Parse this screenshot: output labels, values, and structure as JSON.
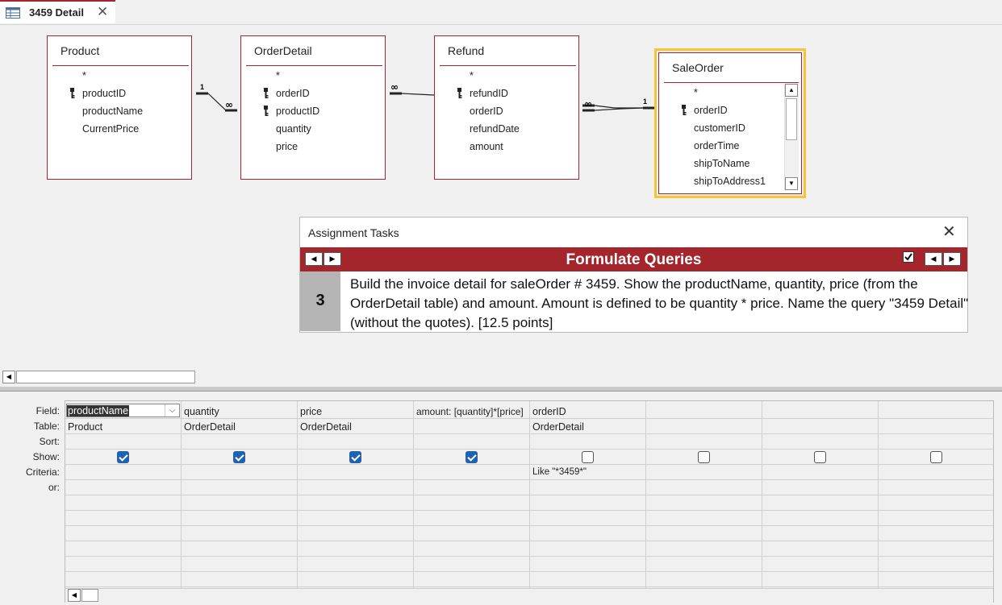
{
  "tab": {
    "title": "3459 Detail"
  },
  "tables": [
    {
      "name": "Product",
      "fields": [
        "*",
        "productID",
        "productName",
        "CurrentPrice"
      ],
      "keys": [
        1
      ]
    },
    {
      "name": "OrderDetail",
      "fields": [
        "*",
        "orderID",
        "productID",
        "quantity",
        "price"
      ],
      "keys": [
        1,
        2
      ]
    },
    {
      "name": "Refund",
      "fields": [
        "*",
        "refundID",
        "orderID",
        "refundDate",
        "amount"
      ],
      "keys": [
        1
      ]
    },
    {
      "name": "SaleOrder",
      "fields": [
        "*",
        "orderID",
        "customerID",
        "orderTime",
        "shipToName",
        "shipToAddress1"
      ],
      "keys": [
        1
      ]
    }
  ],
  "relations": {
    "one": "1",
    "many": "∞"
  },
  "tasks": {
    "title": "Assignment Tasks",
    "heading": "Formulate Queries",
    "number": "3",
    "text": "Build the invoice detail for saleOrder # 3459.  Show the productName, quantity, price (from the OrderDetail table) and amount.  Amount is defined to be quantity * price.  Name the query \"3459 Detail\" (without the quotes). [12.5 points]"
  },
  "grid": {
    "row_labels": [
      "Field:",
      "Table:",
      "Sort:",
      "Show:",
      "Criteria:",
      "or:"
    ],
    "columns": [
      {
        "field": "productName",
        "table": "Product",
        "show": true,
        "criteria": ""
      },
      {
        "field": "quantity",
        "table": "OrderDetail",
        "show": true,
        "criteria": ""
      },
      {
        "field": "price",
        "table": "OrderDetail",
        "show": true,
        "criteria": ""
      },
      {
        "field": "amount: [quantity]*[price]",
        "table": "",
        "show": true,
        "criteria": ""
      },
      {
        "field": "orderID",
        "table": "OrderDetail",
        "show": false,
        "criteria": "Like \"*3459*\""
      },
      {
        "field": "",
        "table": "",
        "show": false,
        "criteria": ""
      },
      {
        "field": "",
        "table": "",
        "show": false,
        "criteria": ""
      },
      {
        "field": "",
        "table": "",
        "show": false,
        "criteria": ""
      }
    ]
  },
  "colors": {
    "accent": "#a4262c",
    "selected_border": "#f8c434",
    "checkbox": "#1f61b4"
  }
}
